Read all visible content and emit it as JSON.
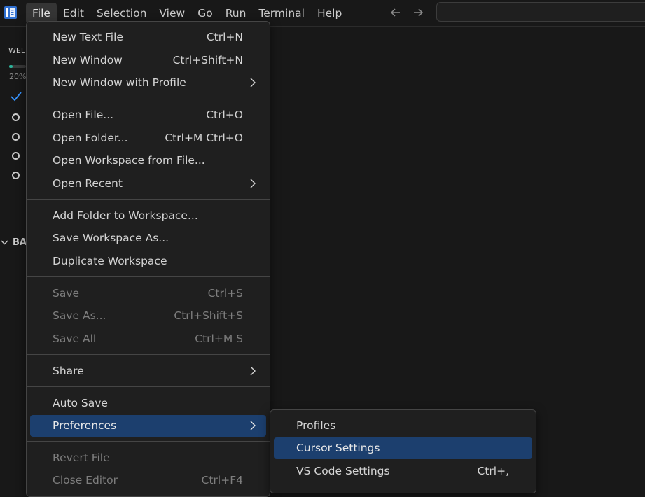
{
  "menubar": {
    "items": [
      {
        "label": "File"
      },
      {
        "label": "Edit"
      },
      {
        "label": "Selection"
      },
      {
        "label": "View"
      },
      {
        "label": "Go"
      },
      {
        "label": "Run"
      },
      {
        "label": "Terminal"
      },
      {
        "label": "Help"
      }
    ],
    "active_index": 0
  },
  "icons": {
    "app": "editor-logo-icon",
    "back": "arrow-left-icon",
    "forward": "arrow-right-icon",
    "check": "check-icon",
    "chevron": "chevron-down-icon",
    "submenu": "chevron-right-icon"
  },
  "sidebar": {
    "walkthrough_title": "WEL",
    "progress_percent": 20,
    "progress_label": "20%",
    "section_label": "BA"
  },
  "file_menu": {
    "items": [
      {
        "label": "New Text File",
        "shortcut": "Ctrl+N"
      },
      {
        "label": "New Window",
        "shortcut": "Ctrl+Shift+N"
      },
      {
        "label": "New Window with Profile",
        "shortcut": ""
      },
      {
        "label": "Open File...",
        "shortcut": "Ctrl+O"
      },
      {
        "label": "Open Folder...",
        "shortcut": "Ctrl+M Ctrl+O"
      },
      {
        "label": "Open Workspace from File...",
        "shortcut": ""
      },
      {
        "label": "Open Recent",
        "shortcut": ""
      },
      {
        "label": "Add Folder to Workspace...",
        "shortcut": ""
      },
      {
        "label": "Save Workspace As...",
        "shortcut": ""
      },
      {
        "label": "Duplicate Workspace",
        "shortcut": ""
      },
      {
        "label": "Save",
        "shortcut": "Ctrl+S"
      },
      {
        "label": "Save As...",
        "shortcut": "Ctrl+Shift+S"
      },
      {
        "label": "Save All",
        "shortcut": "Ctrl+M S"
      },
      {
        "label": "Share",
        "shortcut": ""
      },
      {
        "label": "Auto Save",
        "shortcut": ""
      },
      {
        "label": "Preferences",
        "shortcut": ""
      },
      {
        "label": "Revert File",
        "shortcut": ""
      },
      {
        "label": "Close Editor",
        "shortcut": "Ctrl+F4"
      }
    ]
  },
  "preferences_submenu": {
    "items": [
      {
        "label": "Profiles",
        "shortcut": ""
      },
      {
        "label": "Cursor Settings",
        "shortcut": ""
      },
      {
        "label": "VS Code Settings",
        "shortcut": "Ctrl+,"
      }
    ]
  },
  "colors": {
    "accent": "#1c3f6e",
    "progress": "#2bb39a",
    "check": "#3794ff"
  }
}
